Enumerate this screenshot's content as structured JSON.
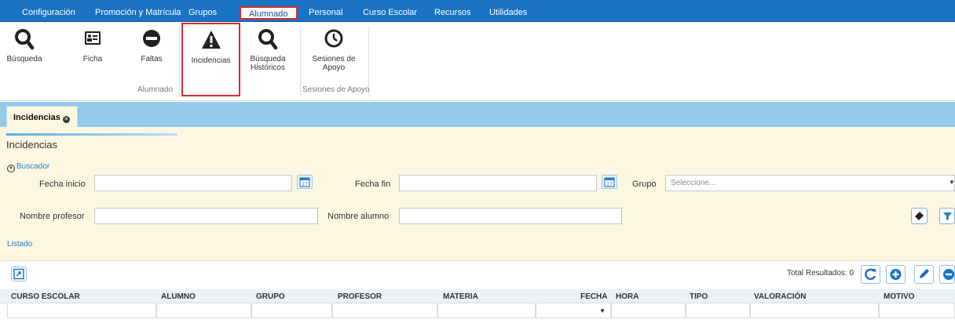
{
  "menu": {
    "items": [
      {
        "label": "Configuración"
      },
      {
        "label": "Promoción y Matrícula"
      },
      {
        "label": "Grupos"
      },
      {
        "label": "Alumnado",
        "active": true
      },
      {
        "label": "Personal"
      },
      {
        "label": "Curso Escolar"
      },
      {
        "label": "Recursos"
      },
      {
        "label": "Utilidades"
      }
    ]
  },
  "ribbon": {
    "busqueda": "Búsqueda",
    "ficha": "Ficha",
    "faltas": "Faltas",
    "incidencias": "Incidencias",
    "busqueda_historicos_1": "Búsqueda",
    "busqueda_historicos_2": "Históricos",
    "sesiones_1": "Sesiones de",
    "sesiones_2": "Apoyo",
    "group_alumnado": "Alumnado",
    "group_sesiones": "Sesiones de Apoyo"
  },
  "tabs": [
    {
      "label": "Incidencias"
    }
  ],
  "page": {
    "title": "Incidencias",
    "buscador": "Buscador",
    "listado": "Listado"
  },
  "filters": {
    "fecha_inicio_label": "Fecha inicio",
    "fecha_inicio_value": "",
    "fecha_fin_label": "Fecha fin",
    "fecha_fin_value": "",
    "grupo_label": "Grupo",
    "grupo_placeholder": "Seleccione...",
    "nombre_profesor_label": "Nombre profesor",
    "nombre_profesor_value": "",
    "nombre_alumno_label": "Nombre alumno",
    "nombre_alumno_value": ""
  },
  "results": {
    "total_label": "Total Resultados:",
    "total_count": "0"
  },
  "table": {
    "columns": [
      "CURSO ESCOLAR",
      "ALUMNO",
      "GRUPO",
      "PROFESOR",
      "MATERIA",
      "FECHA",
      "HORA",
      "TIPO",
      "VALORACIÓN",
      "MOTIVO"
    ],
    "rows": []
  },
  "colors": {
    "menubar": "#1a73c5",
    "tabstrip": "#93cbe9",
    "content_bg": "#fdf6e1",
    "highlight": "#d32f2f",
    "link": "#2a80c9"
  }
}
